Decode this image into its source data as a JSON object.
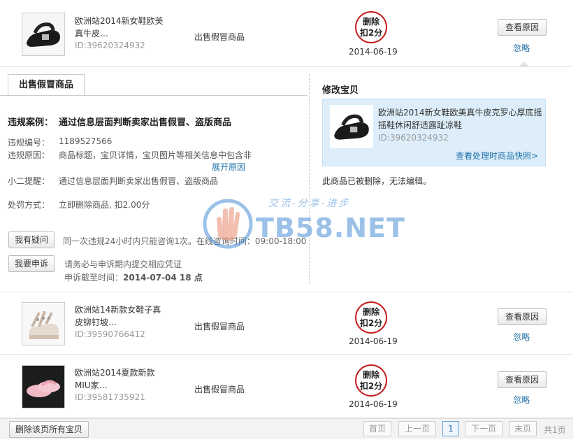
{
  "colors": {
    "link": "#1f6fa8",
    "stamp_border": "#c81e1e",
    "edit_box_bg": "#ddeefa",
    "watermark": "#4a8fd6"
  },
  "items": [
    {
      "title": "欧洲站2014新女鞋欧美真牛皮…",
      "id_text": "ID:39620324932",
      "reason": "出售假冒商品",
      "stamp": [
        "删除",
        "扣2分"
      ],
      "date": "2014-06-19",
      "view_label": "查看原因",
      "ignore_label": "忽略",
      "thumb_icon": "black-sandal-image"
    },
    {
      "title": "欧洲站14新款女鞋子真皮铆钉坡…",
      "id_text": "ID:39590766412",
      "reason": "出售假冒商品",
      "stamp": [
        "删除",
        "扣2分"
      ],
      "date": "2014-06-19",
      "view_label": "查看原因",
      "ignore_label": "忽略",
      "thumb_icon": "studded-sandal-image"
    },
    {
      "title": "欧洲站2014夏款新款MIU家…",
      "id_text": "ID:39581735921",
      "reason": "出售假冒商品",
      "stamp": [
        "删除",
        "扣2分"
      ],
      "date": "2014-06-19",
      "view_label": "查看原因",
      "ignore_label": "忽略",
      "thumb_icon": "pink-slipper-image"
    }
  ],
  "detail": {
    "tab_label": "出售假冒商品",
    "case_label": "违规案例：",
    "case_value": "通过信息层面判断卖家出售假冒、盗版商品",
    "number_label": "违规编号：",
    "number_value": "1189527566",
    "cause_label": "违规原因：",
    "cause_value": "商品标题，宝贝详情，宝贝图片等相关信息中包含非",
    "expand_label": "展开原因",
    "hint_label": "小二提醒：",
    "hint_value": "通过信息层面判断卖家出售假冒、盗版商品",
    "action_label": "处罚方式：",
    "action_value": "立即删除商品, 扣2.00分",
    "question_button": "我有疑问",
    "question_note": "同一次违规24小时内只能咨询1次。在线咨询时间：09:00-18:00",
    "appeal_button": "我要申诉",
    "appeal_note": "请务必与申诉期内提交相应凭证",
    "deadline_label": "申诉截至时间：",
    "deadline_value": "2014-07-04 18 点",
    "edit_title": "修改宝贝",
    "edit_desc": "欧洲站2014新女鞋欧美真牛皮克罗心厚底摇摇鞋休闲舒适露趾凉鞋",
    "edit_id": "ID:39620324932",
    "edit_link": "查看处理时商品快照>",
    "deleted_note": "此商品已被删除，无法编辑。"
  },
  "watermark": {
    "text": "TB58.NET",
    "tagline": "交流-分享-进步"
  },
  "footer": {
    "delete_all": "删除该页所有宝贝",
    "first": "首页",
    "prev": "上一页",
    "current": "1",
    "next": "下一页",
    "last": "末页",
    "total": "共1页"
  }
}
